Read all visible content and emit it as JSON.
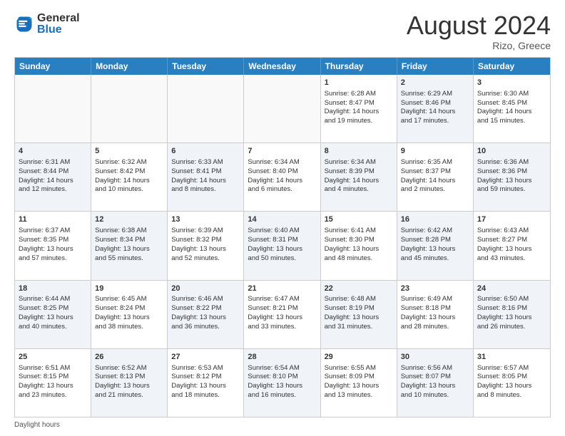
{
  "logo": {
    "general": "General",
    "blue": "Blue"
  },
  "title": "August 2024",
  "location": "Rizo, Greece",
  "footer": "Daylight hours",
  "weekdays": [
    "Sunday",
    "Monday",
    "Tuesday",
    "Wednesday",
    "Thursday",
    "Friday",
    "Saturday"
  ],
  "rows": [
    [
      {
        "day": "",
        "info": "",
        "shaded": false,
        "empty": true
      },
      {
        "day": "",
        "info": "",
        "shaded": false,
        "empty": true
      },
      {
        "day": "",
        "info": "",
        "shaded": false,
        "empty": true
      },
      {
        "day": "",
        "info": "",
        "shaded": false,
        "empty": true
      },
      {
        "day": "1",
        "info": "Sunrise: 6:28 AM\nSunset: 8:47 PM\nDaylight: 14 hours\nand 19 minutes.",
        "shaded": false,
        "empty": false
      },
      {
        "day": "2",
        "info": "Sunrise: 6:29 AM\nSunset: 8:46 PM\nDaylight: 14 hours\nand 17 minutes.",
        "shaded": true,
        "empty": false
      },
      {
        "day": "3",
        "info": "Sunrise: 6:30 AM\nSunset: 8:45 PM\nDaylight: 14 hours\nand 15 minutes.",
        "shaded": false,
        "empty": false
      }
    ],
    [
      {
        "day": "4",
        "info": "Sunrise: 6:31 AM\nSunset: 8:44 PM\nDaylight: 14 hours\nand 12 minutes.",
        "shaded": true,
        "empty": false
      },
      {
        "day": "5",
        "info": "Sunrise: 6:32 AM\nSunset: 8:42 PM\nDaylight: 14 hours\nand 10 minutes.",
        "shaded": false,
        "empty": false
      },
      {
        "day": "6",
        "info": "Sunrise: 6:33 AM\nSunset: 8:41 PM\nDaylight: 14 hours\nand 8 minutes.",
        "shaded": true,
        "empty": false
      },
      {
        "day": "7",
        "info": "Sunrise: 6:34 AM\nSunset: 8:40 PM\nDaylight: 14 hours\nand 6 minutes.",
        "shaded": false,
        "empty": false
      },
      {
        "day": "8",
        "info": "Sunrise: 6:34 AM\nSunset: 8:39 PM\nDaylight: 14 hours\nand 4 minutes.",
        "shaded": true,
        "empty": false
      },
      {
        "day": "9",
        "info": "Sunrise: 6:35 AM\nSunset: 8:37 PM\nDaylight: 14 hours\nand 2 minutes.",
        "shaded": false,
        "empty": false
      },
      {
        "day": "10",
        "info": "Sunrise: 6:36 AM\nSunset: 8:36 PM\nDaylight: 13 hours\nand 59 minutes.",
        "shaded": true,
        "empty": false
      }
    ],
    [
      {
        "day": "11",
        "info": "Sunrise: 6:37 AM\nSunset: 8:35 PM\nDaylight: 13 hours\nand 57 minutes.",
        "shaded": false,
        "empty": false
      },
      {
        "day": "12",
        "info": "Sunrise: 6:38 AM\nSunset: 8:34 PM\nDaylight: 13 hours\nand 55 minutes.",
        "shaded": true,
        "empty": false
      },
      {
        "day": "13",
        "info": "Sunrise: 6:39 AM\nSunset: 8:32 PM\nDaylight: 13 hours\nand 52 minutes.",
        "shaded": false,
        "empty": false
      },
      {
        "day": "14",
        "info": "Sunrise: 6:40 AM\nSunset: 8:31 PM\nDaylight: 13 hours\nand 50 minutes.",
        "shaded": true,
        "empty": false
      },
      {
        "day": "15",
        "info": "Sunrise: 6:41 AM\nSunset: 8:30 PM\nDaylight: 13 hours\nand 48 minutes.",
        "shaded": false,
        "empty": false
      },
      {
        "day": "16",
        "info": "Sunrise: 6:42 AM\nSunset: 8:28 PM\nDaylight: 13 hours\nand 45 minutes.",
        "shaded": true,
        "empty": false
      },
      {
        "day": "17",
        "info": "Sunrise: 6:43 AM\nSunset: 8:27 PM\nDaylight: 13 hours\nand 43 minutes.",
        "shaded": false,
        "empty": false
      }
    ],
    [
      {
        "day": "18",
        "info": "Sunrise: 6:44 AM\nSunset: 8:25 PM\nDaylight: 13 hours\nand 40 minutes.",
        "shaded": true,
        "empty": false
      },
      {
        "day": "19",
        "info": "Sunrise: 6:45 AM\nSunset: 8:24 PM\nDaylight: 13 hours\nand 38 minutes.",
        "shaded": false,
        "empty": false
      },
      {
        "day": "20",
        "info": "Sunrise: 6:46 AM\nSunset: 8:22 PM\nDaylight: 13 hours\nand 36 minutes.",
        "shaded": true,
        "empty": false
      },
      {
        "day": "21",
        "info": "Sunrise: 6:47 AM\nSunset: 8:21 PM\nDaylight: 13 hours\nand 33 minutes.",
        "shaded": false,
        "empty": false
      },
      {
        "day": "22",
        "info": "Sunrise: 6:48 AM\nSunset: 8:19 PM\nDaylight: 13 hours\nand 31 minutes.",
        "shaded": true,
        "empty": false
      },
      {
        "day": "23",
        "info": "Sunrise: 6:49 AM\nSunset: 8:18 PM\nDaylight: 13 hours\nand 28 minutes.",
        "shaded": false,
        "empty": false
      },
      {
        "day": "24",
        "info": "Sunrise: 6:50 AM\nSunset: 8:16 PM\nDaylight: 13 hours\nand 26 minutes.",
        "shaded": true,
        "empty": false
      }
    ],
    [
      {
        "day": "25",
        "info": "Sunrise: 6:51 AM\nSunset: 8:15 PM\nDaylight: 13 hours\nand 23 minutes.",
        "shaded": false,
        "empty": false
      },
      {
        "day": "26",
        "info": "Sunrise: 6:52 AM\nSunset: 8:13 PM\nDaylight: 13 hours\nand 21 minutes.",
        "shaded": true,
        "empty": false
      },
      {
        "day": "27",
        "info": "Sunrise: 6:53 AM\nSunset: 8:12 PM\nDaylight: 13 hours\nand 18 minutes.",
        "shaded": false,
        "empty": false
      },
      {
        "day": "28",
        "info": "Sunrise: 6:54 AM\nSunset: 8:10 PM\nDaylight: 13 hours\nand 16 minutes.",
        "shaded": true,
        "empty": false
      },
      {
        "day": "29",
        "info": "Sunrise: 6:55 AM\nSunset: 8:09 PM\nDaylight: 13 hours\nand 13 minutes.",
        "shaded": false,
        "empty": false
      },
      {
        "day": "30",
        "info": "Sunrise: 6:56 AM\nSunset: 8:07 PM\nDaylight: 13 hours\nand 10 minutes.",
        "shaded": true,
        "empty": false
      },
      {
        "day": "31",
        "info": "Sunrise: 6:57 AM\nSunset: 8:05 PM\nDaylight: 13 hours\nand 8 minutes.",
        "shaded": false,
        "empty": false
      }
    ]
  ]
}
